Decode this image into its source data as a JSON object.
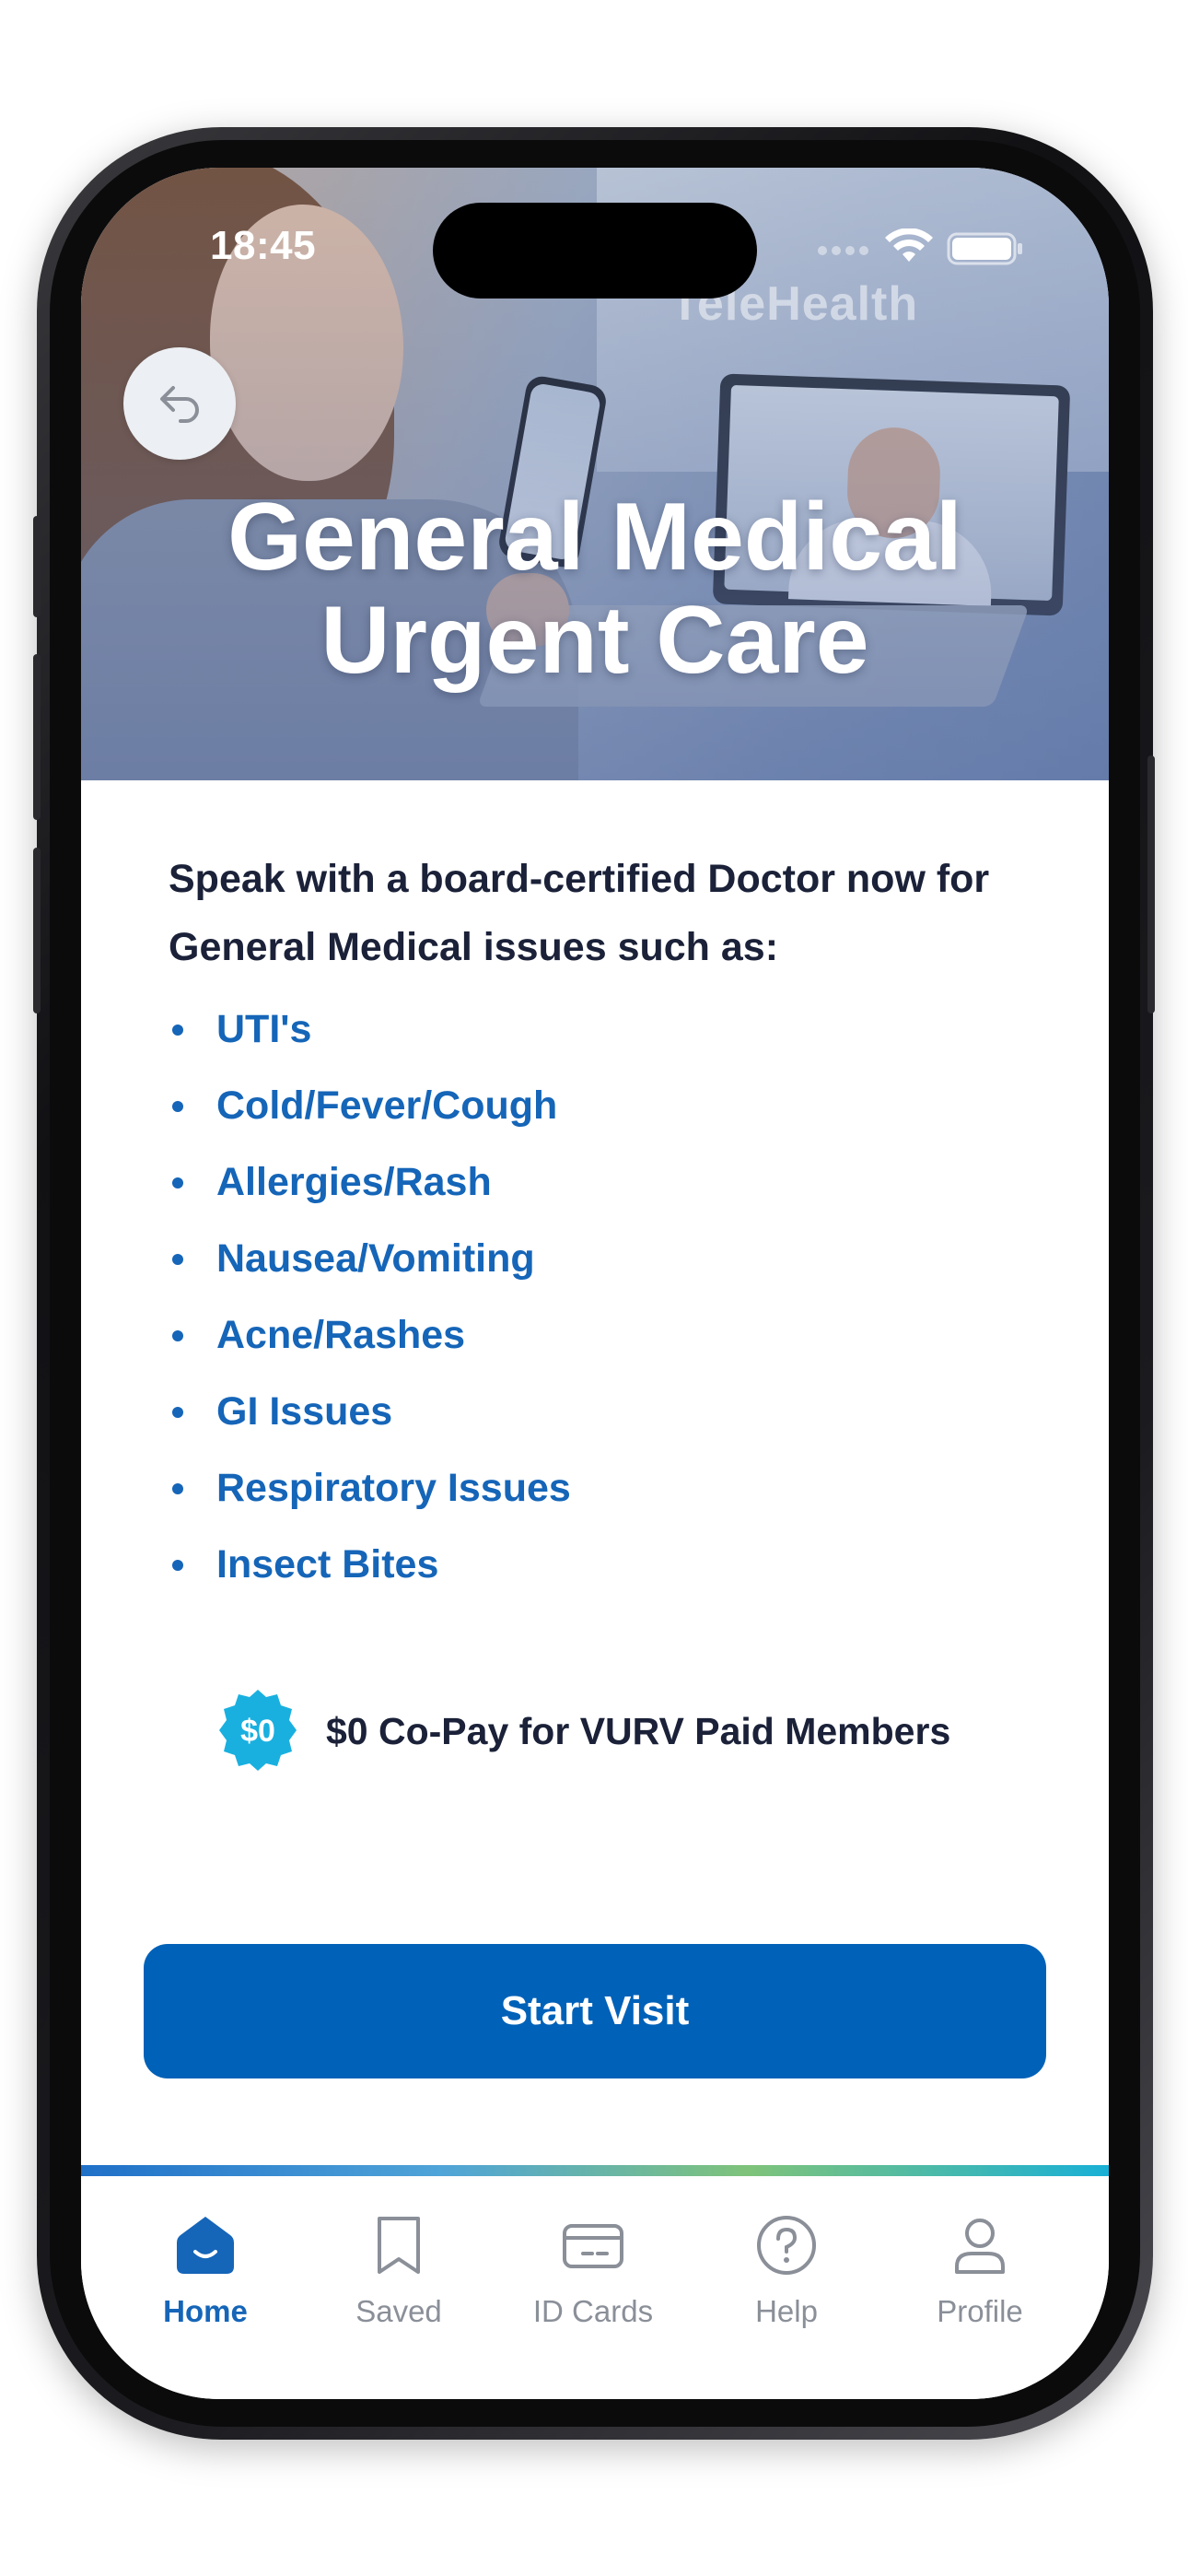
{
  "status_bar": {
    "time": "18:45"
  },
  "hero": {
    "watermark": "TeleHealth",
    "title_line1": "General Medical",
    "title_line2": "Urgent Care"
  },
  "intro": "Speak with a board-certified Doctor now for General Medical issues such as:",
  "conditions": [
    "UTI's",
    "Cold/Fever/Cough",
    "Allergies/Rash",
    "Nausea/Vomiting",
    "Acne/Rashes",
    "GI Issues",
    "Respiratory Issues",
    "Insect Bites"
  ],
  "copay": {
    "badge": "$0",
    "text": "$0 Co-Pay for VURV Paid Members"
  },
  "start_button": "Start Visit",
  "tabs": [
    {
      "label": "Home",
      "icon": "home-icon",
      "active": true
    },
    {
      "label": "Saved",
      "icon": "bookmark-icon",
      "active": false
    },
    {
      "label": "ID Cards",
      "icon": "id-card-icon",
      "active": false
    },
    {
      "label": "Help",
      "icon": "help-icon",
      "active": false
    },
    {
      "label": "Profile",
      "icon": "profile-icon",
      "active": false
    }
  ],
  "colors": {
    "primary": "#0061b8",
    "link_blue": "#1565b8",
    "text_dark": "#1a2138",
    "badge_cyan": "#19b0e0",
    "tab_inactive": "#8a8f98"
  }
}
